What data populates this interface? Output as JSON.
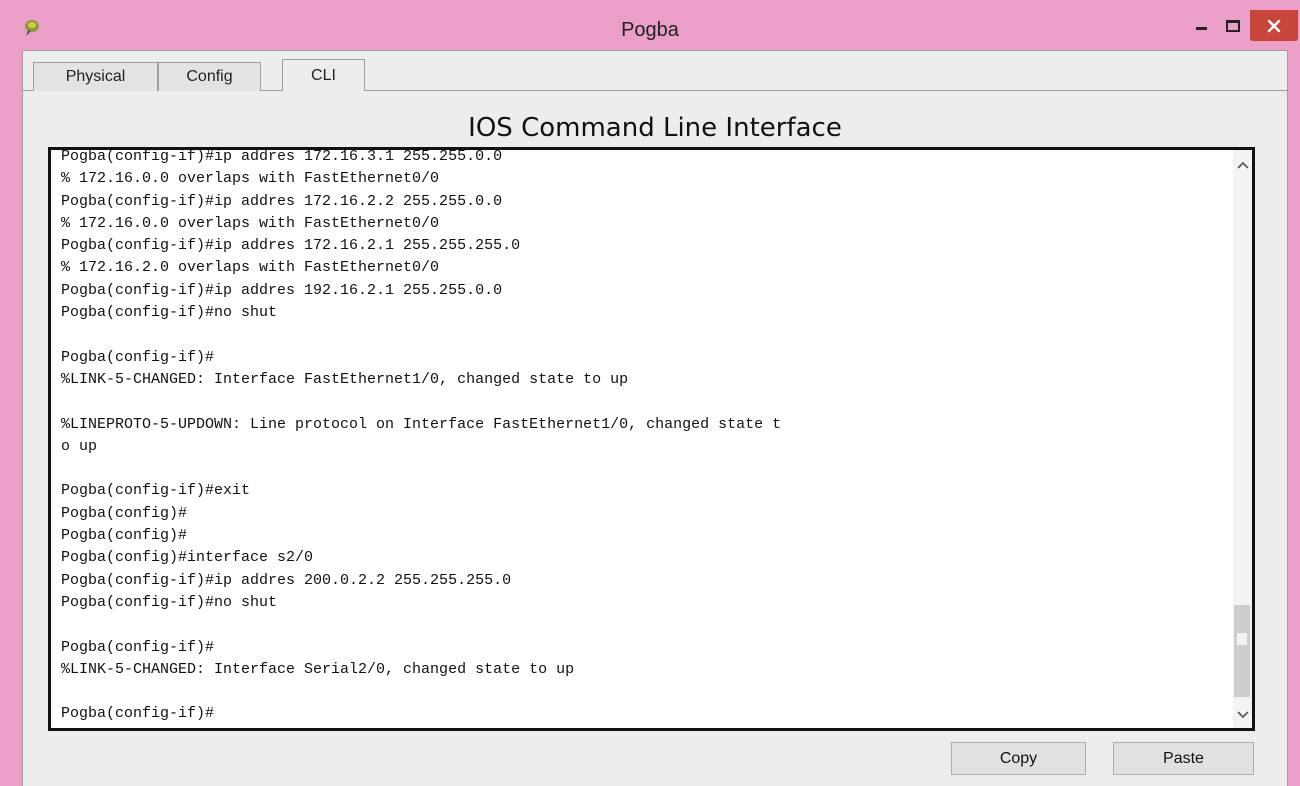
{
  "window": {
    "title": "Pogba",
    "minimize_icon": "minimize-icon",
    "maximize_icon": "maximize-icon",
    "close_icon": "close-icon",
    "close_color": "#c7453a",
    "frame_color": "#eb9ec6"
  },
  "tabs": [
    {
      "label": "Physical",
      "active": false
    },
    {
      "label": "Config",
      "active": false
    },
    {
      "label": "CLI",
      "active": true
    }
  ],
  "cli": {
    "heading": "IOS Command Line Interface",
    "lines": [
      "Pogba(config-if)#ip addres 172.16.3.1 255.255.0.0",
      "% 172.16.0.0 overlaps with FastEthernet0/0",
      "Pogba(config-if)#ip addres 172.16.2.2 255.255.0.0",
      "% 172.16.0.0 overlaps with FastEthernet0/0",
      "Pogba(config-if)#ip addres 172.16.2.1 255.255.255.0",
      "% 172.16.2.0 overlaps with FastEthernet0/0",
      "Pogba(config-if)#ip addres 192.16.2.1 255.255.0.0",
      "Pogba(config-if)#no shut",
      "",
      "Pogba(config-if)#",
      "%LINK-5-CHANGED: Interface FastEthernet1/0, changed state to up",
      "",
      "%LINEPROTO-5-UPDOWN: Line protocol on Interface FastEthernet1/0, changed state t",
      "o up",
      "",
      "Pogba(config-if)#exit",
      "Pogba(config)#",
      "Pogba(config)#",
      "Pogba(config)#interface s2/0",
      "Pogba(config-if)#ip addres 200.0.2.2 255.255.255.0",
      "Pogba(config-if)#no shut",
      "",
      "Pogba(config-if)#",
      "%LINK-5-CHANGED: Interface Serial2/0, changed state to up",
      "",
      "Pogba(config-if)#"
    ]
  },
  "buttons": {
    "copy": "Copy",
    "paste": "Paste"
  }
}
